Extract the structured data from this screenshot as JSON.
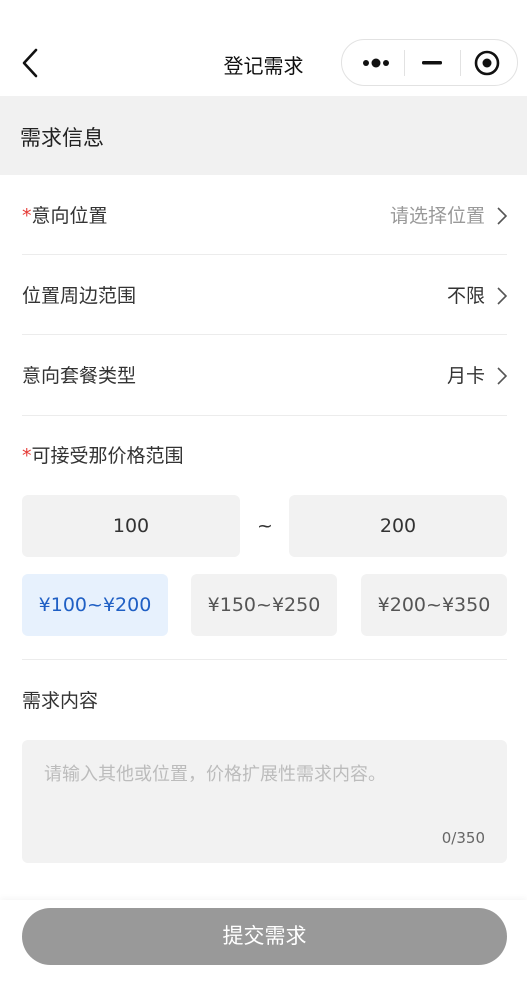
{
  "nav": {
    "title": "登记需求",
    "icons": {
      "back": "chevron-left-icon",
      "more": "more-dots-icon",
      "minimize": "minimize-icon",
      "close": "close-circle-icon"
    }
  },
  "section": {
    "title": "需求信息"
  },
  "fields": {
    "location": {
      "required_mark": "*",
      "label": "意向位置",
      "value": "请选择位置"
    },
    "range": {
      "label": "位置周边范围",
      "value": "不限"
    },
    "package": {
      "label": "意向套餐类型",
      "value": "月卡"
    }
  },
  "price": {
    "required_mark": "*",
    "label": "可接受那价格范围",
    "min": "100",
    "separator": "~",
    "max": "200",
    "options": [
      "¥100~¥200",
      "¥150~¥250",
      "¥200~¥350"
    ],
    "selected_index": 0
  },
  "content": {
    "label": "需求内容",
    "placeholder": "请输入其他或位置，价格扩展性需求内容。",
    "counter": "0/350"
  },
  "submit": {
    "label": "提交需求"
  },
  "colors": {
    "accent": "#1f5fc4",
    "accent_bg": "#e7f1fd",
    "required": "#e53935",
    "submit_bg": "#999999"
  }
}
